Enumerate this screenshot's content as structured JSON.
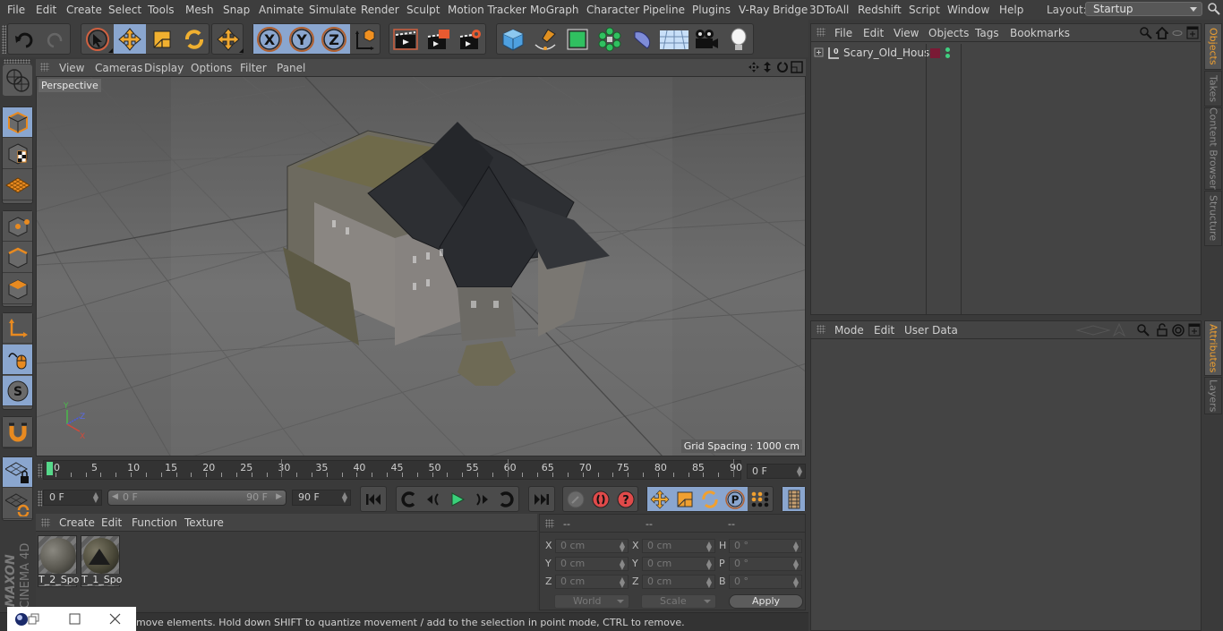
{
  "menubar": {
    "items": [
      "File",
      "Edit",
      "Create",
      "Select",
      "Tools",
      "Mesh",
      "Snap",
      "Animate",
      "Simulate",
      "Render",
      "Sculpt",
      "Motion Tracker",
      "MoGraph",
      "Character",
      "Pipeline",
      "Plugins",
      "V-Ray Bridge",
      "3DToAll",
      "Redshift",
      "Script",
      "Window",
      "Help"
    ],
    "layout_label": "Layout:",
    "layout_value": "Startup"
  },
  "toolbar": {
    "icons": [
      "undo-icon",
      "redo-icon",
      "live-selection-icon",
      "move-icon",
      "scale-icon",
      "rotate-icon",
      "recent-tool-icon",
      "x-axis-lock-icon",
      "y-axis-lock-icon",
      "z-axis-lock-icon",
      "coordinate-system-icon",
      "render-view-icon",
      "render-picture-viewer-icon",
      "render-settings-icon",
      "cube-icon",
      "pen-icon",
      "subdivision-icon",
      "cloner-icon",
      "deformer-icon",
      "floor-icon",
      "camera-icon",
      "light-icon"
    ],
    "axis_labels": [
      "X",
      "Y",
      "Z"
    ]
  },
  "viewport": {
    "menu": [
      "View",
      "Cameras",
      "Display",
      "Options",
      "Filter",
      "Panel"
    ],
    "camera_label": "Perspective",
    "grid_spacing": "Grid Spacing : 1000 cm",
    "axis_labels": {
      "x": "X",
      "y": "Y",
      "z": "Z"
    }
  },
  "timeline": {
    "ticks": [
      "0",
      "5",
      "10",
      "15",
      "20",
      "25",
      "30",
      "35",
      "40",
      "45",
      "50",
      "55",
      "60",
      "65",
      "70",
      "75",
      "80",
      "85",
      "90"
    ],
    "current_frame": "0 F",
    "start_field": "0 F",
    "range_start": "0 F",
    "range_end": "90 F",
    "end_field": "90 F"
  },
  "materials": {
    "menu": [
      "Create",
      "Edit",
      "Function",
      "Texture"
    ],
    "items": [
      {
        "name": "T_2_Spo"
      },
      {
        "name": "T_1_Spo"
      }
    ]
  },
  "coordinates": {
    "headers": [
      "--",
      "--",
      "--"
    ],
    "rows": [
      {
        "l1": "X",
        "v1": "0 cm",
        "l2": "X",
        "v2": "0 cm",
        "l3": "H",
        "v3": "0 °"
      },
      {
        "l1": "Y",
        "v1": "0 cm",
        "l2": "Y",
        "v2": "0 cm",
        "l3": "P",
        "v3": "0 °"
      },
      {
        "l1": "Z",
        "v1": "0 cm",
        "l2": "Z",
        "v2": "0 cm",
        "l3": "B",
        "v3": "0 °"
      }
    ],
    "space_select": "World",
    "mode_select": "Scale",
    "apply_label": "Apply"
  },
  "objects_panel": {
    "menu": [
      "File",
      "Edit",
      "View",
      "Objects",
      "Tags",
      "Bookmarks"
    ],
    "objects": [
      {
        "name": "Scary_Old_House",
        "layer_color": "#7a1a35"
      }
    ]
  },
  "attributes_panel": {
    "menu": [
      "Mode",
      "Edit",
      "User Data"
    ]
  },
  "right_tabs": {
    "top": [
      {
        "label": "Objects",
        "active": true
      },
      {
        "label": "Takes",
        "active": false
      },
      {
        "label": "Content Browser",
        "active": false
      },
      {
        "label": "Structure",
        "active": false
      }
    ],
    "bottom": [
      {
        "label": "Attributes",
        "active": true
      },
      {
        "label": "Layers",
        "active": false
      }
    ]
  },
  "branding": {
    "maxon": "MAXON",
    "product": "CINEMA 4D"
  },
  "status": "move elements. Hold down SHIFT to quantize movement / add to the selection in point mode, CTRL to remove.",
  "colors": {
    "accent_blue": "#8aa6cf",
    "tab_active": "#f0a030",
    "playhead": "#56d88a",
    "icon_orange": "#f0a030"
  }
}
